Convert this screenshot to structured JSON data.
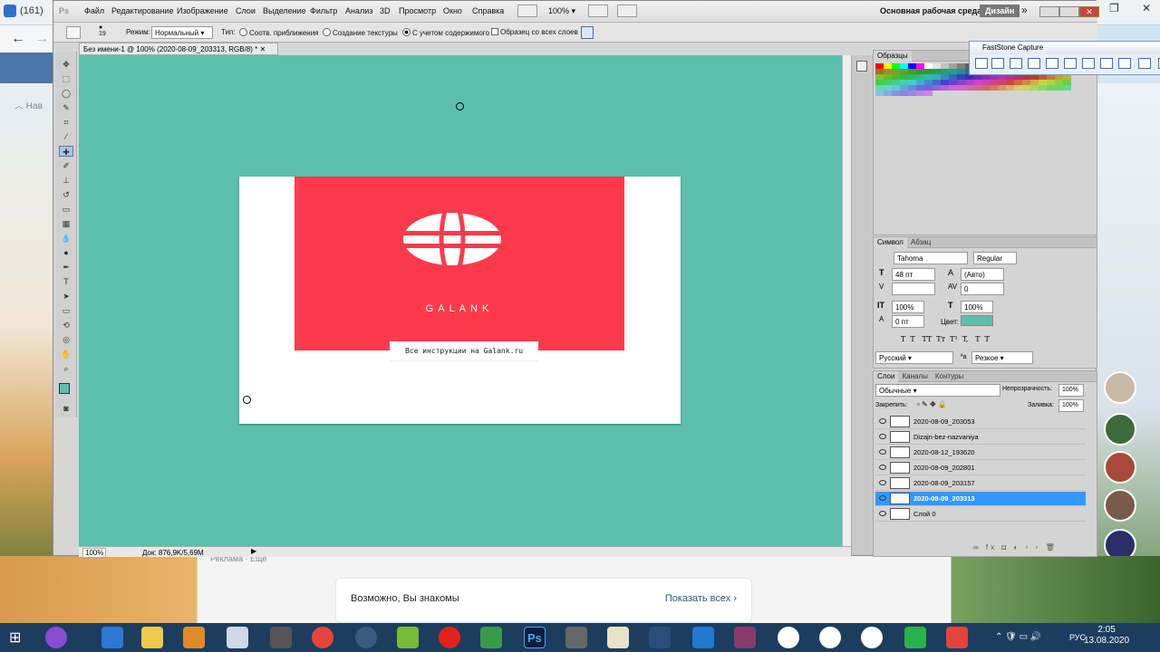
{
  "browser": {
    "tab_text": "(161)",
    "nav_hint": "Нав",
    "vk_ads": "Реклама · Ещё",
    "vk_card_title": "Возможно, Вы знакомы",
    "vk_card_link": "Показать всех"
  },
  "photoshop": {
    "menu": [
      "Файл",
      "Редактирование",
      "Изображение",
      "Слои",
      "Выделение",
      "Фильтр",
      "Анализ",
      "3D",
      "Просмотр",
      "Окно",
      "Справка"
    ],
    "zoom_menu": "100%",
    "workspace": "Основная рабочая среда",
    "design_button": "Дизайн",
    "options": {
      "brush_size": "19",
      "mode_label": "Режим:",
      "mode_value": "Нормальный",
      "type_label": "Тип:",
      "radio1": "Соотв. приближения",
      "radio2": "Создание текстуры",
      "radio3": "С учетом содержимого",
      "checkbox": "Образец со всех слоев"
    },
    "doc_tab": "Без имени-1 @ 100% (2020-08-09_203313, RGB/8) *",
    "status_zoom": "100%",
    "status_doc": "Док: 876,9K/5,69M",
    "canvas": {
      "brand": "GALANK",
      "caption": "Все инструкции на Galank.ru"
    },
    "panels": {
      "swatches_tab": "Образцы",
      "char_tabs": [
        "Символ",
        "Абзац"
      ],
      "font": "Tahoma",
      "style": "Regular",
      "size": "48 пт",
      "leading": "(Авто)",
      "tracking": "0",
      "vscale": "100%",
      "hscale": "100%",
      "baseline": "0 пт",
      "color_label": "Цвет:",
      "color": "#5cbfac",
      "type_buttons": "T  T   TT  Tт  T¹  T,   T  T",
      "language": "Русский",
      "aa_label": "ªa",
      "antialias": "Резкое",
      "layer_tabs": [
        "Слои",
        "Каналы",
        "Контуры"
      ],
      "blend": "Обычные",
      "opacity_label": "Непрозрачность:",
      "opacity": "100%",
      "lock_label": "Закрепить:",
      "fill_label": "Заливка:",
      "fill": "100%",
      "layers": [
        {
          "name": "2020-08-09_203053",
          "selected": false
        },
        {
          "name": "Dizajn-bez-nazvaniya",
          "selected": false
        },
        {
          "name": "2020-08-12_193620",
          "selected": false
        },
        {
          "name": "2020-08-09_202801",
          "selected": false
        },
        {
          "name": "2020-08-09_203157",
          "selected": false
        },
        {
          "name": "2020-08-09_203313",
          "selected": true
        },
        {
          "name": "Слой 0",
          "selected": false
        }
      ]
    },
    "faststone_title": "FastStone Capture"
  },
  "taskbar": {
    "lang": "РУС",
    "time": "2:05",
    "date": "13.08.2020"
  }
}
